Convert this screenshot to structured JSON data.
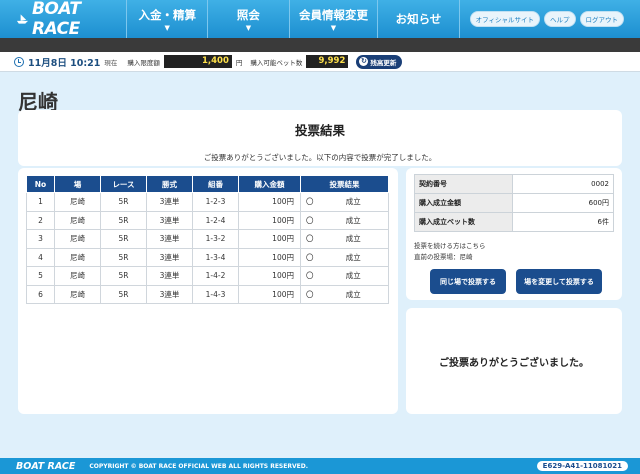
{
  "header": {
    "logo": "BOAT RACE",
    "nav": [
      {
        "label": "入金・精算",
        "has_menu": true
      },
      {
        "label": "照会",
        "has_menu": true
      },
      {
        "label": "会員情報変更",
        "has_menu": true
      },
      {
        "label": "お知らせ",
        "has_menu": false
      }
    ],
    "links": [
      "オフィシャルサイト",
      "ヘルプ",
      "ログアウト"
    ]
  },
  "status": {
    "datetime": "11月8日 10:21",
    "current": "現在",
    "limit_label": "購入限度額",
    "limit_value": "1,400",
    "yen": "円",
    "bets_label": "購入可能ベット数",
    "bets_value": "9,992",
    "refresh_label": "残高更新"
  },
  "page_title": "尼崎",
  "result": {
    "heading": "投票結果",
    "message": "ご投票ありがとうございました。以下の内容で投票が完了しました。",
    "columns": [
      "No",
      "場",
      "レース",
      "勝式",
      "組番",
      "購入金額",
      "投票結果"
    ],
    "rows": [
      {
        "no": "1",
        "venue": "尼崎",
        "race": "5R",
        "type": "3連単",
        "combo": "1-2-3",
        "amount": "100円",
        "mark": "〇",
        "status": "成立"
      },
      {
        "no": "2",
        "venue": "尼崎",
        "race": "5R",
        "type": "3連単",
        "combo": "1-2-4",
        "amount": "100円",
        "mark": "〇",
        "status": "成立"
      },
      {
        "no": "3",
        "venue": "尼崎",
        "race": "5R",
        "type": "3連単",
        "combo": "1-3-2",
        "amount": "100円",
        "mark": "〇",
        "status": "成立"
      },
      {
        "no": "4",
        "venue": "尼崎",
        "race": "5R",
        "type": "3連単",
        "combo": "1-3-4",
        "amount": "100円",
        "mark": "〇",
        "status": "成立"
      },
      {
        "no": "5",
        "venue": "尼崎",
        "race": "5R",
        "type": "3連単",
        "combo": "1-4-2",
        "amount": "100円",
        "mark": "〇",
        "status": "成立"
      },
      {
        "no": "6",
        "venue": "尼崎",
        "race": "5R",
        "type": "3連単",
        "combo": "1-4-3",
        "amount": "100円",
        "mark": "〇",
        "status": "成立"
      }
    ]
  },
  "summary": {
    "rows": [
      {
        "label": "契約番号",
        "value": "0002"
      },
      {
        "label": "購入成立金額",
        "value": "600円"
      },
      {
        "label": "購入成立ベット数",
        "value": "6件"
      }
    ],
    "continue_text": "投票を続ける方はこちら",
    "prev_venue_text": "直前の投票場：尼崎",
    "same_button": "同じ場で投票する",
    "change_button": "場を変更して投票する",
    "thanks": "ご投票ありがとうございました。"
  },
  "footer": {
    "logo": "BOAT RACE",
    "copyright": "COPYRIGHT © BOAT RACE OFFICIAL WEB ALL RIGHTS RESERVED.",
    "code": "E629-A41-11081021"
  },
  "colors": {
    "header": "#1d8fd0",
    "navy": "#1b4d8e",
    "background": "#dff0fb"
  }
}
